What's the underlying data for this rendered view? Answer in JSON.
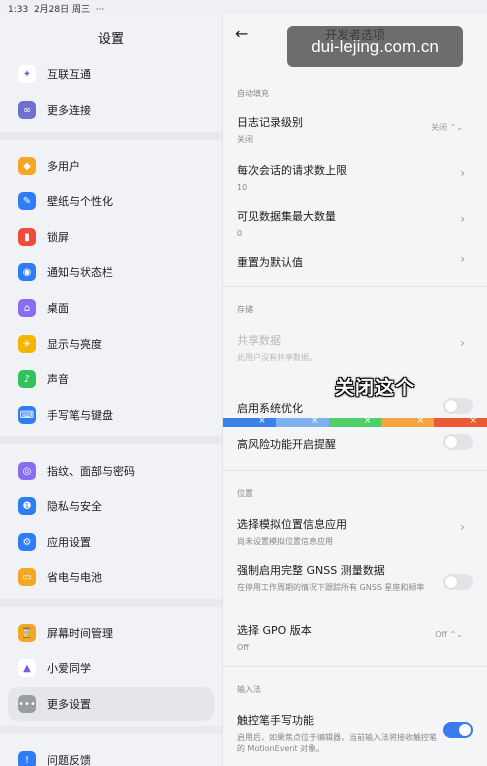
{
  "statusbar": {
    "time": "1:33",
    "date": "2月28日 周三",
    "dots": "···"
  },
  "left": {
    "title": "设置",
    "items": [
      {
        "label": "互联互通",
        "color": "#ffffff",
        "glyph": "✦",
        "fg": "#7a5bd6"
      },
      {
        "label": "更多连接",
        "color": "#6f6fd0",
        "glyph": "∞"
      },
      {
        "label": "多用户",
        "color": "#f5a623",
        "glyph": "◆"
      },
      {
        "label": "壁纸与个性化",
        "color": "#2f7df6",
        "glyph": "✎"
      },
      {
        "label": "锁屏",
        "color": "#f04a3c",
        "glyph": "▮"
      },
      {
        "label": "通知与状态栏",
        "color": "#2f7df6",
        "glyph": "◉"
      },
      {
        "label": "桌面",
        "color": "#8a6cf0",
        "glyph": "⌂"
      },
      {
        "label": "显示与亮度",
        "color": "#f5b400",
        "glyph": "☀"
      },
      {
        "label": "声音",
        "color": "#31c15e",
        "glyph": "♪"
      },
      {
        "label": "手写笔与键盘",
        "color": "#2f7df6",
        "glyph": "⌨"
      },
      {
        "label": "指纹、面部与密码",
        "color": "#8a6cf0",
        "glyph": "◎"
      },
      {
        "label": "隐私与安全",
        "color": "#2f7df6",
        "glyph": "❶"
      },
      {
        "label": "应用设置",
        "color": "#2f7df6",
        "glyph": "⚙"
      },
      {
        "label": "省电与电池",
        "color": "#f5a623",
        "glyph": "▭"
      },
      {
        "label": "屏幕时间管理",
        "color": "#f5a623",
        "glyph": "⌛"
      },
      {
        "label": "小爱同学",
        "color": "#ffffff",
        "glyph": "▲",
        "fg": "#7a5bd6"
      },
      {
        "label": "更多设置",
        "color": "#9a9ca3",
        "glyph": "•••"
      },
      {
        "label": "问题反馈",
        "color": "#2f7df6",
        "glyph": "!"
      }
    ]
  },
  "right": {
    "back_glyph": "←",
    "title": "开发者选项",
    "sections": {
      "autofill": "自动填充",
      "storage": "存储",
      "location": "位置",
      "input": "输入法"
    },
    "rows": {
      "log_level": {
        "title": "日志记录级别",
        "sub": "关闭",
        "value": "关闭 ⌃⌄"
      },
      "max_requests": {
        "title": "每次会话的请求数上限",
        "sub": "10"
      },
      "max_datasets": {
        "title": "可见数据集最大数量",
        "sub": "0"
      },
      "reset_default": {
        "title": "重置为默认值"
      },
      "shared_data": {
        "title": "共享数据",
        "sub": "此用户没有共享数据。"
      },
      "sys_opt": {
        "title": "启用系统优化"
      },
      "high_risk": {
        "title": "高风险功能开启提醒"
      },
      "mock_location": {
        "title": "选择模拟位置信息应用",
        "sub": "尚未设置模拟位置信息应用"
      },
      "gnss": {
        "title": "强制启用完整 GNSS 测量数据",
        "sub": "在停用工作周期的情况下跟踪所有 GNSS 星座和频率"
      },
      "gpo": {
        "title": "选择 GPO 版本",
        "sub": "Off",
        "value": "Off ⌃⌄"
      },
      "stylus": {
        "title": "触控笔手写功能",
        "sub": "启用后，如果焦点位于编辑器，当前输入法将接收触控笔的 MotionEvent 对象。"
      }
    },
    "chevron": "›"
  },
  "overlay": {
    "caption": "关闭这个"
  },
  "watermark": "dui-lejing.com.cn"
}
